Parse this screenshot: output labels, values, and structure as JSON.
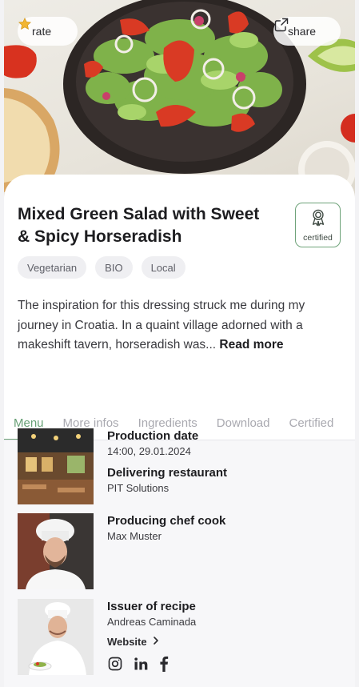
{
  "hero": {
    "rate_label": "rate",
    "share_label": "share"
  },
  "recipe": {
    "title": "Mixed Green Salad with Sweet & Spicy Horseradish",
    "certified_label": "certified",
    "tags": [
      "Vegetarian",
      "BIO",
      "Local"
    ],
    "description": "The inspiration for this dressing struck me during my journey in Croatia. In a quaint village adorned with a makeshift tavern, horseradish was...",
    "read_more": "Read more"
  },
  "tabs": [
    "Menu",
    "More infos",
    "Ingredients",
    "Download",
    "Certified"
  ],
  "active_tab": "Menu",
  "details": {
    "production_date_label": "Production date",
    "production_date_value": "14:00, 29.01.2024",
    "restaurant_label": "Delivering restaurant",
    "restaurant_value": "PIT Solutions",
    "chef_label": "Producing chef cook",
    "chef_value": "Max Muster",
    "issuer_label": "Issuer of recipe",
    "issuer_value": "Andreas Caminada",
    "website_label": "Website"
  },
  "icons": {
    "rate": "star-icon",
    "share": "share-icon",
    "certified": "award-ribbon-icon",
    "social": [
      "instagram-icon",
      "linkedin-icon",
      "facebook-icon"
    ]
  },
  "colors": {
    "accent": "#6fa37a",
    "star": "#f2b632"
  }
}
